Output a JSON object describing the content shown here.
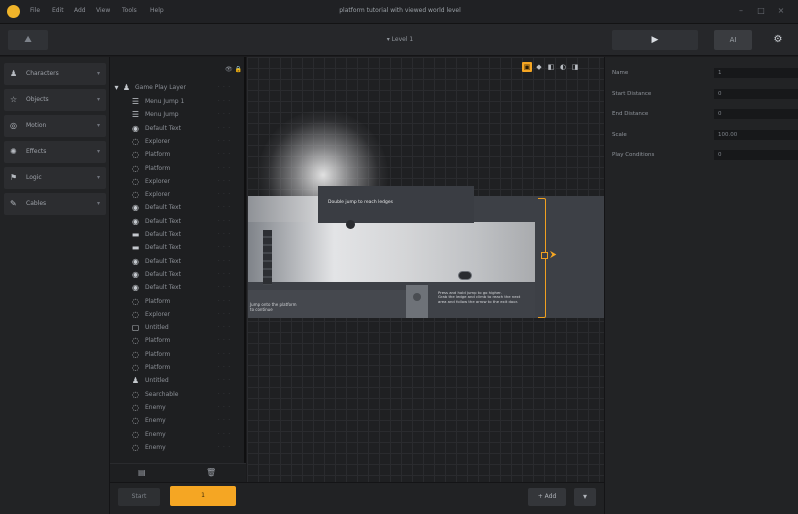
{
  "titlebar": {
    "menus": [
      "File",
      "Edit",
      "Add",
      "View",
      "Tools",
      "Help"
    ],
    "title": "platform tutorial with viewed world level"
  },
  "toolbar": {
    "home_icon": "mountain-icon",
    "level": "Level 1",
    "play_icon": "▶",
    "ai_label": "AI",
    "gear_icon": "⚙"
  },
  "sidebar": {
    "categories": [
      {
        "label": "Characters",
        "icon": "person-icon",
        "glyph": "♟"
      },
      {
        "label": "Objects",
        "icon": "star-icon",
        "glyph": "☆"
      },
      {
        "label": "Motion",
        "icon": "motion-icon",
        "glyph": "◎"
      },
      {
        "label": "Effects",
        "icon": "effects-icon",
        "glyph": "✺"
      },
      {
        "label": "Logic",
        "icon": "logic-icon",
        "glyph": "⚑"
      },
      {
        "label": "Cables",
        "icon": "cable-icon",
        "glyph": "✎"
      }
    ]
  },
  "tree": {
    "root": "Game Play Layer",
    "items": [
      {
        "label": "Menu Jump 1",
        "glyph": "☰",
        "depth": 1
      },
      {
        "label": "Menu Jump",
        "glyph": "☰",
        "depth": 1
      },
      {
        "label": "Default Text",
        "glyph": "◉",
        "depth": 1
      },
      {
        "label": "Explorer",
        "glyph": "◌",
        "depth": 1
      },
      {
        "label": "Platform",
        "glyph": "◌",
        "depth": 1
      },
      {
        "label": "Platform",
        "glyph": "◌",
        "depth": 1
      },
      {
        "label": "Explorer",
        "glyph": "◌",
        "depth": 1
      },
      {
        "label": "Explorer",
        "glyph": "◌",
        "depth": 1
      },
      {
        "label": "Default Text",
        "glyph": "◉",
        "depth": 1
      },
      {
        "label": "Default Text",
        "glyph": "◉",
        "depth": 1
      },
      {
        "label": "Default Text",
        "glyph": "▬",
        "depth": 1
      },
      {
        "label": "Default Text",
        "glyph": "▬",
        "depth": 1
      },
      {
        "label": "Default Text",
        "glyph": "◉",
        "depth": 1
      },
      {
        "label": "Default Text",
        "glyph": "◉",
        "depth": 1
      },
      {
        "label": "Default Text",
        "glyph": "◉",
        "depth": 1
      },
      {
        "label": "Platform",
        "glyph": "◌",
        "depth": 1
      },
      {
        "label": "Explorer",
        "glyph": "◌",
        "depth": 1
      },
      {
        "label": "Untitled",
        "glyph": "▢",
        "depth": 1
      },
      {
        "label": "Platform",
        "glyph": "◌",
        "depth": 1
      },
      {
        "label": "Platform",
        "glyph": "◌",
        "depth": 1
      },
      {
        "label": "Platform",
        "glyph": "◌",
        "depth": 1
      },
      {
        "label": "Untitled",
        "glyph": "♟",
        "depth": 1
      },
      {
        "label": "Searchable",
        "glyph": "◌",
        "depth": 1
      },
      {
        "label": "Enemy",
        "glyph": "◌",
        "depth": 1
      },
      {
        "label": "Enemy",
        "glyph": "◌",
        "depth": 1
      },
      {
        "label": "Enemy",
        "glyph": "◌",
        "depth": 1
      },
      {
        "label": "Enemy",
        "glyph": "◌",
        "depth": 1
      }
    ]
  },
  "canvas": {
    "tools": [
      "▣",
      "◆",
      "◧",
      "◐",
      "◨"
    ],
    "note_top": "Double jump to reach ledges",
    "note_left": [
      "Jump onto the platform",
      "to continue"
    ],
    "note_right": [
      "Press and hold jump to go higher.",
      "Grab the ledge and climb to reach the next",
      "area and follow the arrow to the exit door."
    ],
    "exit_arrow": "⮞"
  },
  "bottom": {
    "left_label": "Start",
    "orange_label": "1",
    "add_label": "+ Add",
    "more_label": "▾"
  },
  "properties": [
    {
      "label": "Name",
      "value": "1"
    },
    {
      "label": "Start Distance",
      "value": "0"
    },
    {
      "label": "End Distance",
      "value": "0"
    },
    {
      "label": "Scale",
      "value": "100.00"
    },
    {
      "label": "Play Conditions",
      "value": "0"
    }
  ]
}
